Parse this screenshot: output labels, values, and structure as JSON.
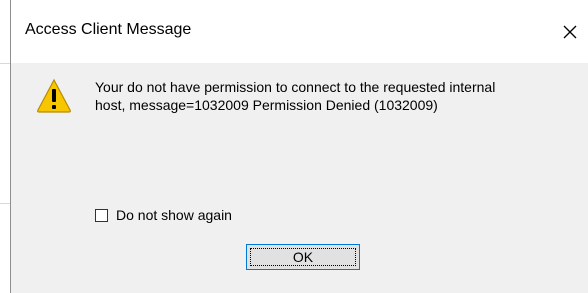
{
  "dialog": {
    "title": "Access Client Message",
    "close_icon": "close-icon",
    "warning_icon": "warning-icon",
    "message_lines": [
      "Your do not have permission to connect to the requested internal",
      "host, message=1032009 Permission Denied (1032009)"
    ],
    "checkbox": {
      "label": "Do not show again",
      "checked": false
    },
    "ok_label": "OK"
  },
  "colors": {
    "warning_yellow": "#f7c600",
    "focus_border": "#0078d7"
  }
}
